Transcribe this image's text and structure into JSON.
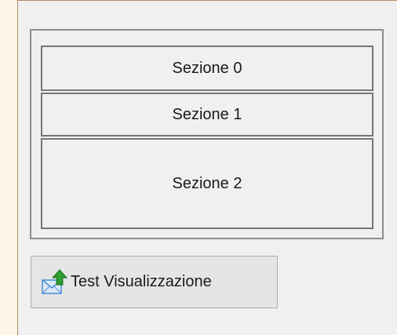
{
  "sections": [
    {
      "label": "Sezione 0"
    },
    {
      "label": "Sezione 1"
    },
    {
      "label": "Sezione 2"
    }
  ],
  "test_button": {
    "label": "Test Visualizzazione",
    "icon": "envelope-upload-icon"
  },
  "colors": {
    "outer_background": "#fdf5e8",
    "form_background": "#f0f0f0",
    "icon_arrow": "#2e9d2e",
    "icon_envelope": "#4a8fd6"
  }
}
